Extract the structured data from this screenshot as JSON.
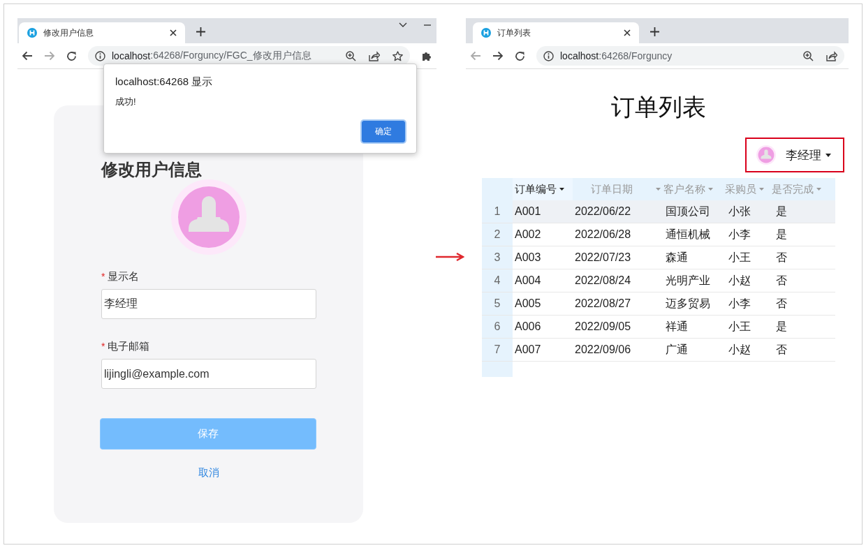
{
  "windows": [
    {
      "kind": "form",
      "tab": {
        "title": "修改用户信息"
      },
      "nav": {
        "back_disabled": false,
        "forward_disabled": true
      },
      "address": {
        "host": "localhost",
        "path": ":64268/Forguncy/FGC_修改用户信息"
      },
      "address_icons": [
        {
          "kind": "zoom"
        },
        {
          "kind": "share"
        },
        {
          "kind": "star"
        }
      ],
      "toolbar_icons": [
        {
          "kind": "puzzle"
        }
      ],
      "window_controls": [
        {
          "kind": "chevron"
        },
        {
          "kind": "minimize"
        }
      ],
      "card": {
        "title": "修改用户信息",
        "fields": [
          {
            "mark": "*",
            "label": "显示名",
            "value": "李经理"
          },
          {
            "mark": "*",
            "label": "电子邮箱",
            "value": "lijingli@example.com"
          }
        ],
        "save": "保存",
        "cancel": "取消"
      },
      "dialog": {
        "title": "localhost:64268 显示",
        "message": "成功!",
        "ok": "确定"
      }
    },
    {
      "kind": "list",
      "tab": {
        "title": "订单列表"
      },
      "nav": {
        "back_disabled": true,
        "forward_disabled": false
      },
      "address": {
        "host": "localhost",
        "path": ":64268/Forguncy"
      },
      "address_icons": [
        {
          "kind": "zoom"
        },
        {
          "kind": "share"
        }
      ],
      "page": {
        "title": "订单列表",
        "user": "李经理",
        "table": {
          "columns": [
            {
              "label": "订单编号",
              "selected": true
            },
            {
              "label": "订单日期",
              "selected": false
            },
            {
              "label": "客户名称",
              "selected": false
            },
            {
              "label": "采购员",
              "selected": false
            },
            {
              "label": "是否完成",
              "selected": false
            }
          ],
          "rows": [
            {
              "number": "1",
              "selected": true,
              "cells": [
                "A001",
                "2022/06/22",
                "国顶公司",
                "小张",
                "是"
              ]
            },
            {
              "number": "2",
              "selected": false,
              "cells": [
                "A002",
                "2022/06/28",
                "通恒机械",
                "小李",
                "是"
              ]
            },
            {
              "number": "3",
              "selected": false,
              "cells": [
                "A003",
                "2022/07/23",
                "森通",
                "小王",
                "否"
              ]
            },
            {
              "number": "4",
              "selected": false,
              "cells": [
                "A004",
                "2022/08/24",
                "光明产业",
                "小赵",
                "否"
              ]
            },
            {
              "number": "5",
              "selected": false,
              "cells": [
                "A005",
                "2022/08/27",
                "迈多贸易",
                "小李",
                "否"
              ]
            },
            {
              "number": "6",
              "selected": false,
              "cells": [
                "A006",
                "2022/09/05",
                "祥通",
                "小王",
                "是"
              ]
            },
            {
              "number": "7",
              "selected": false,
              "cells": [
                "A007",
                "2022/09/06",
                "广通",
                "小赵",
                "否"
              ]
            }
          ]
        }
      }
    }
  ]
}
